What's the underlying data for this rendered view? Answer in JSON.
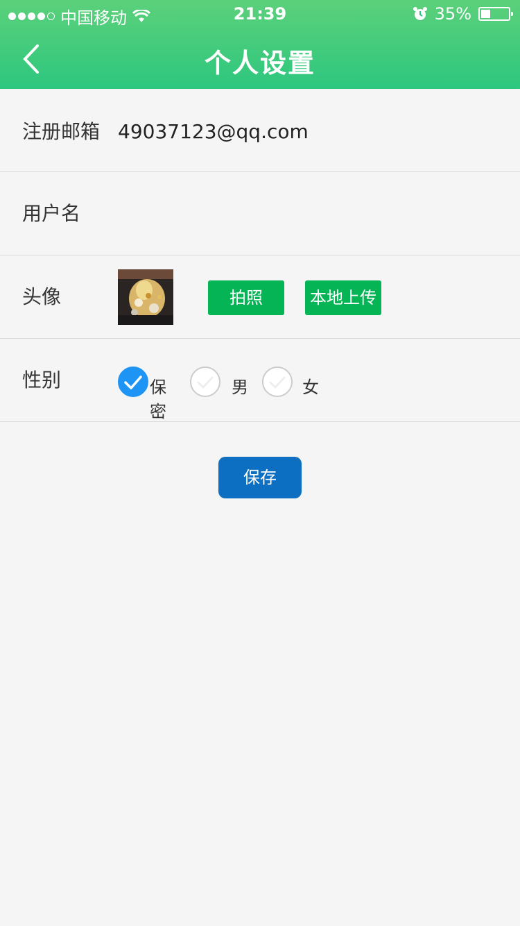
{
  "status_bar": {
    "carrier": "中国移动",
    "time": "21:39",
    "battery": "35%",
    "battery_level": 0.35,
    "signal_bars": 4
  },
  "nav": {
    "title": "个人设置",
    "back_icon": "chevron-left-icon"
  },
  "form": {
    "email": {
      "label": "注册邮箱",
      "value": "49037123@qq.com"
    },
    "username": {
      "label": "用户名",
      "value": ""
    },
    "avatar": {
      "label": "头像",
      "take_photo": "拍照",
      "upload_local": "本地上传"
    },
    "gender": {
      "label": "性别",
      "options": [
        "保密",
        "男",
        "女"
      ],
      "selected": "保密"
    }
  },
  "save_button": "保存",
  "colors": {
    "header_green": "#2dc77f",
    "button_green": "#05b555",
    "save_blue": "#0c6fc2",
    "radio_blue": "#1e95f4"
  }
}
